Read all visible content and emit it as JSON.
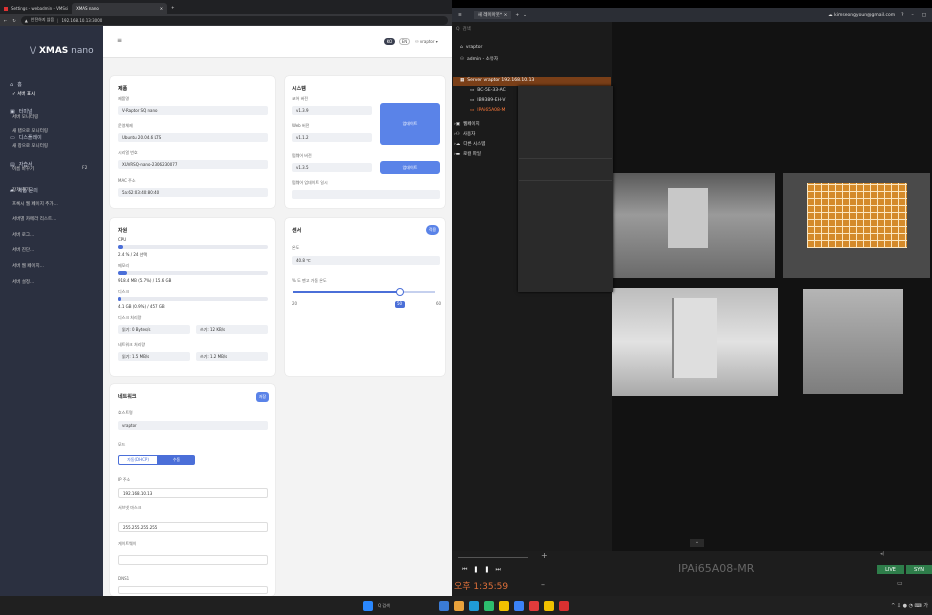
{
  "browser": {
    "tabs": [
      {
        "label": "Settings - webadmin - VMSsi"
      },
      {
        "label": "XMAS nano"
      }
    ],
    "url_warning": "안전하지 않음",
    "url": "192.168.10.13:3000"
  },
  "app": {
    "logo_prefix": "\\/ ",
    "logo_name": "XMAS",
    "logo_suffix": " nano",
    "sidebar": [
      "홈",
      "터미널",
      "디스플레이",
      "자습서",
      "제품 문의"
    ],
    "topbar": {
      "lang_ko": "KO",
      "lang_en": "EN",
      "user": "vraptor"
    }
  },
  "product": {
    "title": "제품",
    "model_label": "제품명",
    "model": "V-Raptor SQ nano",
    "os_label": "운영체제",
    "os": "Ubuntu 20.04.6 LTS",
    "serial_label": "시리얼 번호",
    "serial": "XUVRSQ-nano-2306230077",
    "mac_label": "MAC 주소",
    "mac": "5a:62:03:40:80:40"
  },
  "system": {
    "title": "시스템",
    "core_label": "코어 버전",
    "core": "v1.3.9",
    "web_label": "Web 버전",
    "web": "v1.1.2",
    "fw_label": "펌웨어 버전",
    "fw": "v1.3.5",
    "fw_date_label": "펌웨어 업데이트 일시",
    "update1": "업데이트",
    "update2": "업데이트"
  },
  "resources": {
    "title": "자원",
    "cpu_label": "CPU",
    "cpu_value": "2.4 % / 24 선택",
    "cpu_pct": 3,
    "mem_label": "메모리",
    "mem_value": "918.4 MB (5.7%) / 15.6 GB",
    "mem_pct": 6,
    "disk_label": "디스크",
    "disk_value": "4.1 GB (0.9%) / 457 GB",
    "disk_pct": 1,
    "diskio_label": "디스크 처리량",
    "disk_read": "읽기: 0 Bytes/s",
    "disk_write": "쓰기: 12 KB/s",
    "net_label": "네트워크 처리량",
    "net_read": "읽기: 1.5 MB/s",
    "net_write": "쓰기: 1.2 MB/s"
  },
  "sensor": {
    "title": "센서",
    "button": "적용",
    "temp_label": "온도",
    "temp": "40.8 ℃",
    "fan_label": "% 도 팬고 가동 온도",
    "min": "20",
    "value": "50",
    "max": "60",
    "slider_pct": 75
  },
  "network": {
    "title": "네트워크",
    "button": "저장",
    "host_label": "호스트명",
    "host": "vraptor",
    "mode_label": "모드",
    "mode_auto": "자동(DHCP)",
    "mode_manual": "수동",
    "ip_label": "IP 주소",
    "ip": "192.168.10.13",
    "mask_label": "서브넷 마스크",
    "mask": "255.255.255.255",
    "gw_label": "게이트웨이",
    "dns_label": "DNS1"
  },
  "vms": {
    "tab": "새 레이아웃*",
    "account": "kimseongyoun@gmail.com",
    "search": "검색",
    "user_node": "vraptor",
    "admin_node": "admin - 소유자",
    "server_node": "Server vraptor  192.168.10.13",
    "cameras": [
      "BC-5E-33-AC",
      "IB9389-EH-V",
      "IPAi65A08-M"
    ],
    "tree_more": [
      "웹페이지",
      "사용자",
      "다른 시스템",
      "로컬 파일"
    ],
    "context_menu": [
      "서버 표시",
      "서버 모니터링",
      "새 탭으로 모니터링",
      "새 창으로 모니터링",
      "이름 바꾸기",
      "장치 추가...",
      "프록시 웹 페이지 추가...",
      "서버별 카메라 리스트...",
      "서버 로그...",
      "서버 진단...",
      "서버 웹 페이지...",
      "서버 설정..."
    ],
    "rename_shortcut": "F2",
    "timeline": {
      "time": "오후 1:35:59",
      "camera_name": "IPAi65A08-MR",
      "live": "LIVE",
      "sync": "SYN"
    }
  }
}
